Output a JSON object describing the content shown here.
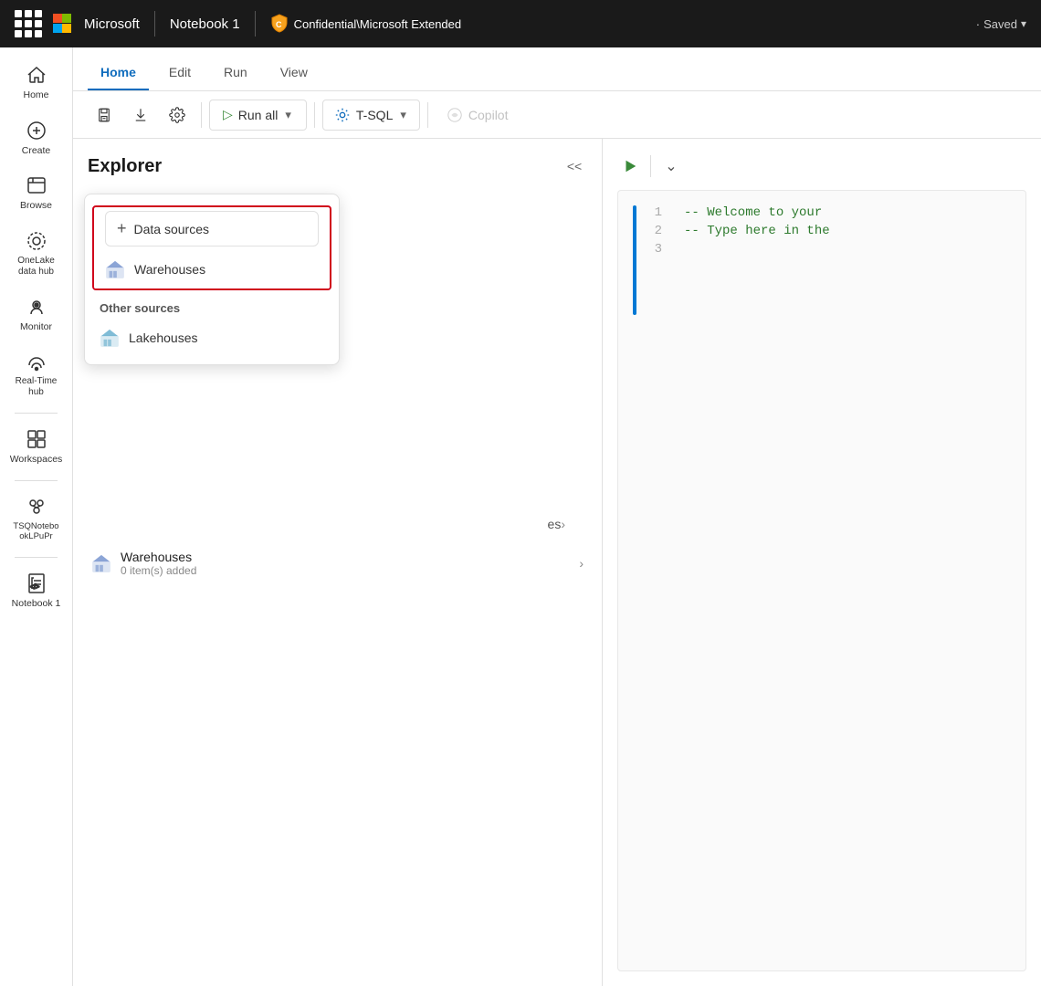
{
  "topbar": {
    "app_name": "Microsoft",
    "notebook_name": "Notebook 1",
    "badge_label": "Confidential\\Microsoft Extended",
    "saved_status": "Saved"
  },
  "tabs": {
    "items": [
      {
        "label": "Home",
        "active": true
      },
      {
        "label": "Edit",
        "active": false
      },
      {
        "label": "Run",
        "active": false
      },
      {
        "label": "View",
        "active": false
      }
    ]
  },
  "toolbar": {
    "run_all_label": "Run all",
    "tsql_label": "T-SQL",
    "copilot_label": "Copilot"
  },
  "sidebar": {
    "items": [
      {
        "label": "Home",
        "icon": "home-icon"
      },
      {
        "label": "Create",
        "icon": "create-icon"
      },
      {
        "label": "Browse",
        "icon": "browse-icon"
      },
      {
        "label": "OneLake\ndata hub",
        "icon": "onelake-icon"
      },
      {
        "label": "Monitor",
        "icon": "monitor-icon"
      },
      {
        "label": "Real-Time\nhub",
        "icon": "realtime-icon"
      },
      {
        "label": "Workspaces",
        "icon": "workspaces-icon"
      },
      {
        "label": "TSQNotebo\nokLPuPr",
        "icon": "tsq-icon"
      },
      {
        "label": "Notebook 1",
        "icon": "notebook-icon"
      }
    ]
  },
  "explorer": {
    "title": "Explorer",
    "collapse_label": "<<",
    "dropdown": {
      "add_datasource_label": "Data sources",
      "highlighted_item": "Warehouses",
      "other_sources_label": "Other sources",
      "lakehouses_label": "Lakehouses"
    },
    "tree": {
      "warehouses_label": "Warehouses",
      "warehouses_sub": "0 item(s) added",
      "other_sources_partial": "es"
    }
  },
  "code_editor": {
    "line1": "-- Welcome to your",
    "line2": "-- Type here in the",
    "line3": ""
  },
  "colors": {
    "active_tab": "#0f6cbd",
    "highlight_border": "#d0021b",
    "play_green": "#3a8a3a",
    "blue_bar": "#0078d4"
  }
}
